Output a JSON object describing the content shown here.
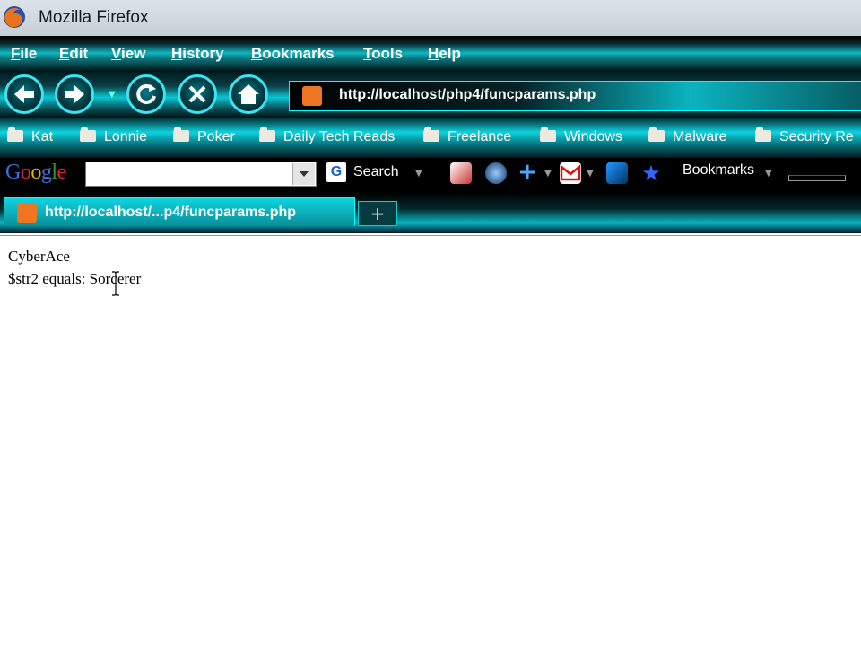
{
  "window": {
    "title": "Mozilla Firefox"
  },
  "menu": [
    "File",
    "Edit",
    "View",
    "History",
    "Bookmarks",
    "Tools",
    "Help"
  ],
  "address": {
    "url": "http://localhost/php4/funcparams.php"
  },
  "bookmarks": [
    "Kat",
    "Lonnie",
    "Poker",
    "Daily Tech Reads",
    "Freelance",
    "Windows",
    "Malware",
    "Security Re"
  ],
  "google_toolbar": {
    "logo": "Google",
    "search_value": "",
    "search_label": "Search",
    "bookmarks_label": "Bookmarks"
  },
  "tabs": [
    {
      "label": "http://localhost/...p4/funcparams.php",
      "active": true
    }
  ],
  "new_tab": "+",
  "page": {
    "line1": "CyberAce",
    "line2": "$str2 equals: Sorcerer"
  },
  "colors": {
    "accent": "#0ed4e0",
    "chrome_dark": "#02181c",
    "site_icon": "#f07522"
  }
}
